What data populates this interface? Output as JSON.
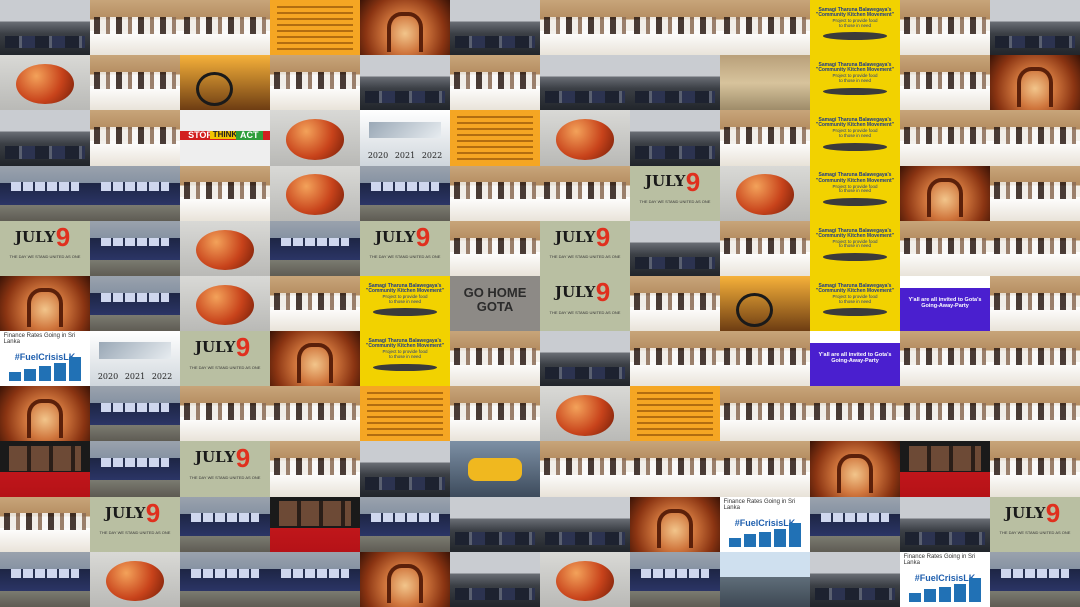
{
  "image_description_type": "photo-collage-mosaic",
  "grid": {
    "columns": 12,
    "rows": 11
  },
  "texts": {
    "july_month": "JULY",
    "july_day": "9",
    "july_sub": "THE DAY WE STAND UNITED AS ONE",
    "go_home": "GO HOME\nGOTA",
    "stop": "STOP",
    "think": "THINK",
    "act": "ACT",
    "kitchen_title": "Samagi Tharuna Balawegaya's\n\"Community Kitchen Movement\"",
    "kitchen_body": "Project to provide food\nto those in need",
    "tweet_text": "Y'all are all invited to Gota's\nGoing-Away-Party",
    "year_2020": "2020",
    "year_2021": "2021",
    "year_2022": "2022",
    "chart_title": "Finance Rates Going in Sri Lanka",
    "chart_tag": "#FuelCrisisLK"
  },
  "colors": {
    "july_num": "#e0301e",
    "go_home_text": "#2b2b2b",
    "stop": "#d21f1f",
    "think": "#f3c400",
    "act": "#2e9e3a",
    "kitchen_text": "#1d3b8a",
    "tweet_text": "#ffffff"
  },
  "tiles": [
    [
      "traffic",
      "meeting",
      "meeting",
      "notice",
      "monument",
      "traffic",
      "meeting",
      "meeting",
      "meeting",
      "kitchen",
      "meeting",
      "traffic"
    ],
    [
      "mango",
      "meeting",
      "bike",
      "meeting",
      "traffic",
      "meeting",
      "traffic",
      "traffic",
      "beach",
      "kitchen",
      "meeting",
      "monument"
    ],
    [
      "traffic",
      "meeting",
      "stop",
      "mango",
      "calendar",
      "notice",
      "mango",
      "traffic",
      "meeting",
      "kitchen",
      "meeting",
      "meeting"
    ],
    [
      "bus",
      "bus",
      "meeting",
      "mango",
      "bus",
      "meeting",
      "meeting",
      "july",
      "mango",
      "kitchen",
      "monument",
      "meeting"
    ],
    [
      "july",
      "bus",
      "mango",
      "bus",
      "july",
      "meeting",
      "july",
      "traffic",
      "meeting",
      "kitchen",
      "meeting",
      "meeting"
    ],
    [
      "monument",
      "bus",
      "mango",
      "meeting",
      "kitchen",
      "gohome",
      "july",
      "meeting",
      "bike",
      "kitchen",
      "tweet",
      "meeting"
    ],
    [
      "ggrid",
      "calendar",
      "july",
      "monument",
      "kitchen",
      "meeting",
      "traffic",
      "meeting",
      "meeting",
      "tweet",
      "meeting",
      "meeting"
    ],
    [
      "monument",
      "bus",
      "meeting",
      "meeting",
      "notice",
      "meeting",
      "mango",
      "notice",
      "meeting",
      "meeting",
      "meeting",
      "meeting"
    ],
    [
      "poster",
      "bus",
      "july",
      "meeting",
      "traffic",
      "jcb",
      "meeting",
      "meeting",
      "meeting",
      "monument",
      "poster",
      "meeting"
    ],
    [
      "meeting",
      "july",
      "bus",
      "poster",
      "bus",
      "traffic",
      "traffic",
      "monument",
      "ggrid",
      "bus",
      "traffic",
      "july"
    ],
    [
      "bus",
      "mango",
      "bus",
      "bus",
      "monument",
      "traffic",
      "mango",
      "bus",
      "city",
      "traffic",
      "ggrid",
      "bus"
    ]
  ]
}
